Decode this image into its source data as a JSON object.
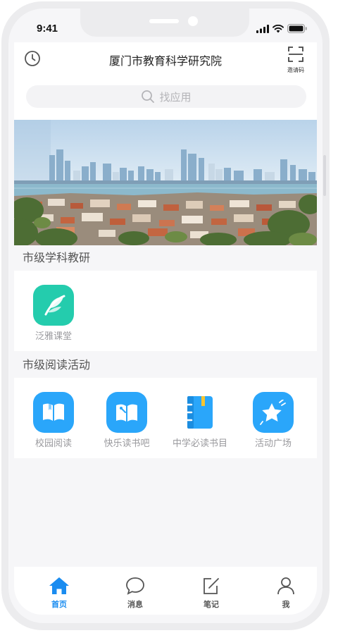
{
  "status_bar": {
    "time": "9:41"
  },
  "header": {
    "title": "厦门市教育科学研究院",
    "scan_label": "邀请码"
  },
  "search": {
    "placeholder": "找应用"
  },
  "sections": [
    {
      "title": "市级学科教研",
      "apps": [
        {
          "label": "泛雅课堂",
          "icon": "leaf-icon",
          "color": "#24ccad"
        }
      ]
    },
    {
      "title": "市级阅读活动",
      "apps": [
        {
          "label": "校园阅读",
          "icon": "book-icon",
          "color": "#2aa6fa"
        },
        {
          "label": "快乐读书吧",
          "icon": "reading-book-icon",
          "color": "#2aa6fa"
        },
        {
          "label": "中学必读书目",
          "icon": "notebook-icon",
          "color": "#2aa6fa"
        },
        {
          "label": "活动广场",
          "icon": "star-icon",
          "color": "#2aa6fa"
        }
      ]
    }
  ],
  "tabbar": {
    "items": [
      {
        "label": "首页",
        "icon": "home-icon",
        "active": true
      },
      {
        "label": "消息",
        "icon": "message-icon",
        "active": false
      },
      {
        "label": "笔记",
        "icon": "note-icon",
        "active": false
      },
      {
        "label": "我",
        "icon": "profile-icon",
        "active": false
      }
    ]
  },
  "colors": {
    "accent": "#1a8cf0",
    "teal": "#24ccad",
    "blue": "#2aa6fa"
  }
}
